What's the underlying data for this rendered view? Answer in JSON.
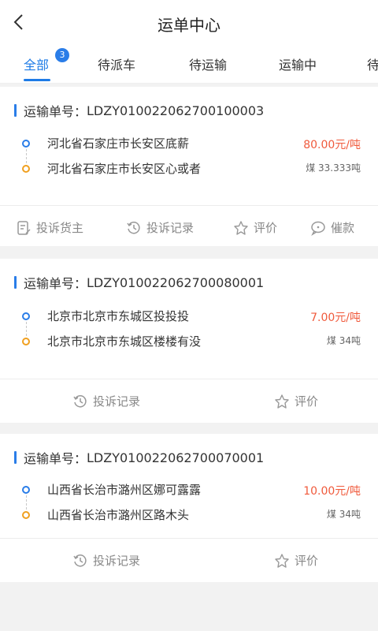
{
  "header": {
    "title": "运单中心"
  },
  "tabs": [
    {
      "label": "全部",
      "badge": "3"
    },
    {
      "label": "待派车"
    },
    {
      "label": "待运输"
    },
    {
      "label": "运输中"
    },
    {
      "label": "待"
    }
  ],
  "orders": [
    {
      "order_label": "运输单号：",
      "order_no": "LDZY010022062700100003",
      "from": "河北省石家庄市长安区底薪",
      "to": "河北省石家庄市长安区心或者",
      "price": "80.00元/吨",
      "cargo": "煤  33.333吨",
      "actions": [
        "投诉货主",
        "投诉记录",
        "评价",
        "催款"
      ]
    },
    {
      "order_label": "运输单号：",
      "order_no": "LDZY010022062700080001",
      "from": "北京市北京市东城区投投投",
      "to": "北京市北京市东城区楼楼有没",
      "price": "7.00元/吨",
      "cargo": "煤  34吨",
      "actions": [
        "投诉记录",
        "评价"
      ]
    },
    {
      "order_label": "运输单号：",
      "order_no": "LDZY010022062700070001",
      "from": "山西省长治市潞州区娜可露露",
      "to": "山西省长治市潞州区路木头",
      "price": "10.00元/吨",
      "cargo": "煤  34吨",
      "actions": [
        "投诉记录",
        "评价"
      ]
    }
  ],
  "colors": {
    "accent": "#2a7de8",
    "price": "#f05a3c",
    "destination": "#f0a020"
  },
  "icons": [
    "back-arrow-icon",
    "complain-icon",
    "history-icon",
    "rating-icon",
    "payment-reminder-icon"
  ]
}
